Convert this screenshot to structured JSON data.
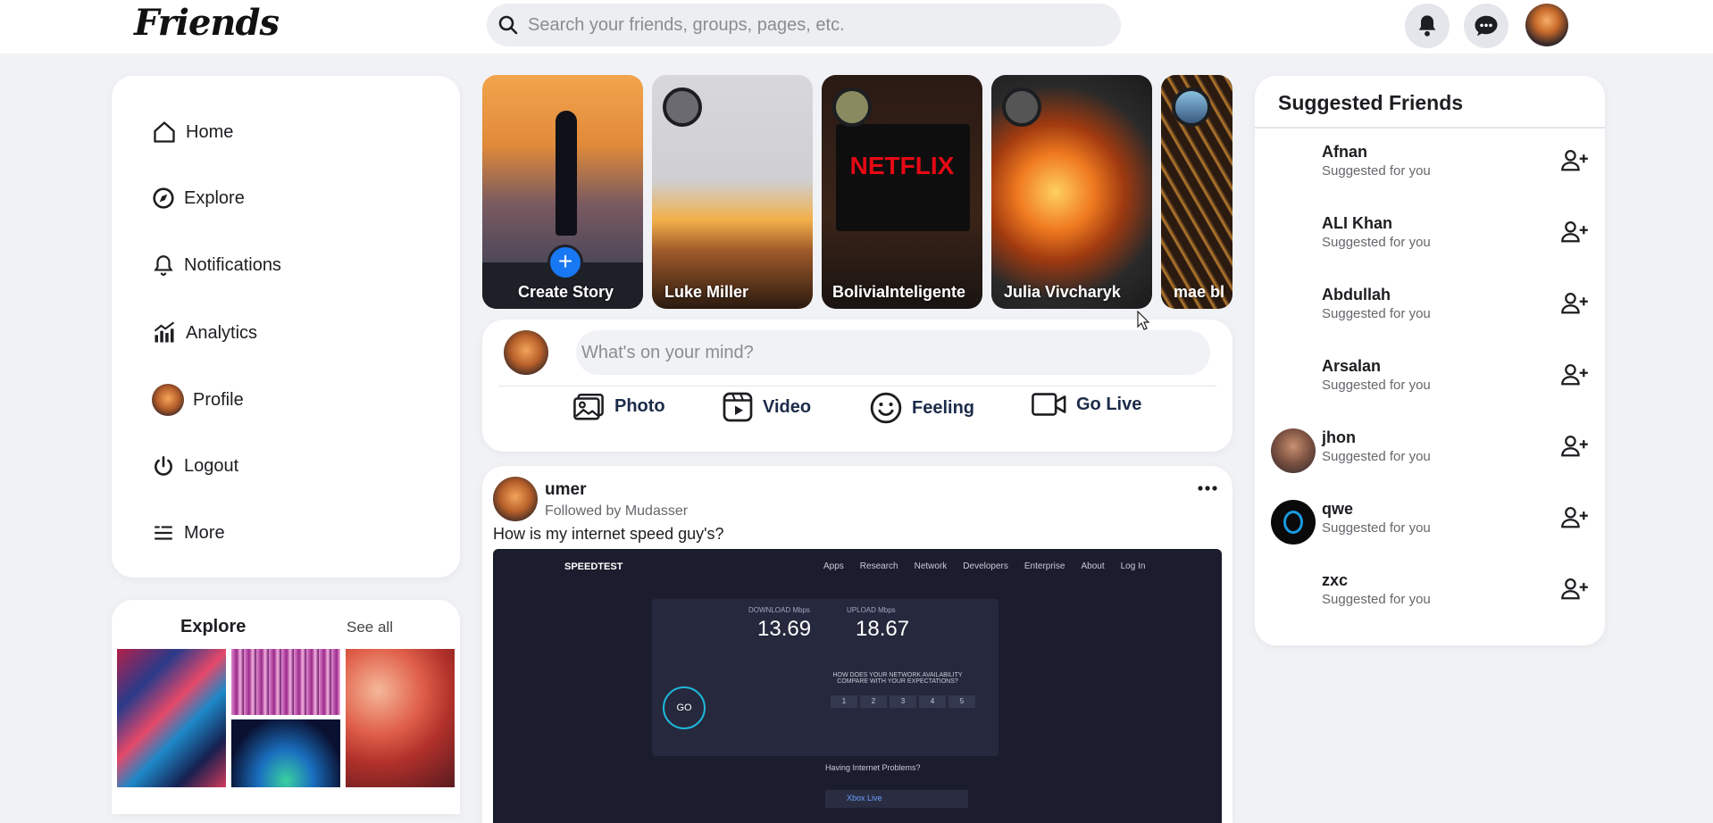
{
  "app": {
    "logo_text": "Friends"
  },
  "search": {
    "placeholder": "Search your friends, groups, pages, etc."
  },
  "menu": {
    "items": [
      {
        "label": "Home",
        "icon": "home-icon"
      },
      {
        "label": "Explore",
        "icon": "compass-icon"
      },
      {
        "label": "Notifications",
        "icon": "bell-icon"
      },
      {
        "label": "Analytics",
        "icon": "chart-icon"
      },
      {
        "label": "Profile",
        "icon": "avatar"
      },
      {
        "label": "Logout",
        "icon": "power-icon"
      },
      {
        "label": "More",
        "icon": "more-lines-icon"
      }
    ]
  },
  "explore": {
    "title": "Explore",
    "see_all": "See all"
  },
  "stories": [
    {
      "label": "Create Story"
    },
    {
      "label": "Luke Miller"
    },
    {
      "label": "BoliviaInteligente",
      "brand_text": "NETFLIX"
    },
    {
      "label": "Julia Vivcharyk"
    },
    {
      "label": "mae bl"
    }
  ],
  "composer": {
    "placeholder": "What's on your mind?",
    "actions": [
      "Photo",
      "Video",
      "Feeling",
      "Go Live"
    ]
  },
  "post": {
    "author": "umer",
    "subtitle": "Followed by Mudasser",
    "text": "How is my internet speed guy's?",
    "screenshot": {
      "brand": "SPEEDTEST",
      "nav": [
        "Apps",
        "Research",
        "Network",
        "Developers",
        "Enterprise",
        "About",
        "Log In"
      ],
      "download_label": "DOWNLOAD Mbps",
      "download": "13.69",
      "upload_label": "UPLOAD Mbps",
      "upload": "18.67",
      "go": "GO",
      "question": "HOW DOES YOUR NETWORK AVAILABILITY COMPARE WITH YOUR EXPECTATIONS?",
      "ratings": [
        "1",
        "2",
        "3",
        "4",
        "5"
      ],
      "problems": "Having Internet Problems?",
      "service": "Xbox Live"
    }
  },
  "suggested": {
    "title": "Suggested Friends",
    "subtitle": "Suggested for you",
    "people": [
      {
        "name": "Afnan"
      },
      {
        "name": "ALI Khan"
      },
      {
        "name": "Abdullah"
      },
      {
        "name": "Arsalan"
      },
      {
        "name": "jhon"
      },
      {
        "name": "qwe"
      },
      {
        "name": "zxc"
      }
    ]
  },
  "colors": {
    "accent": "#1877f2",
    "background": "#f0f2f5",
    "card": "#ffffff"
  }
}
